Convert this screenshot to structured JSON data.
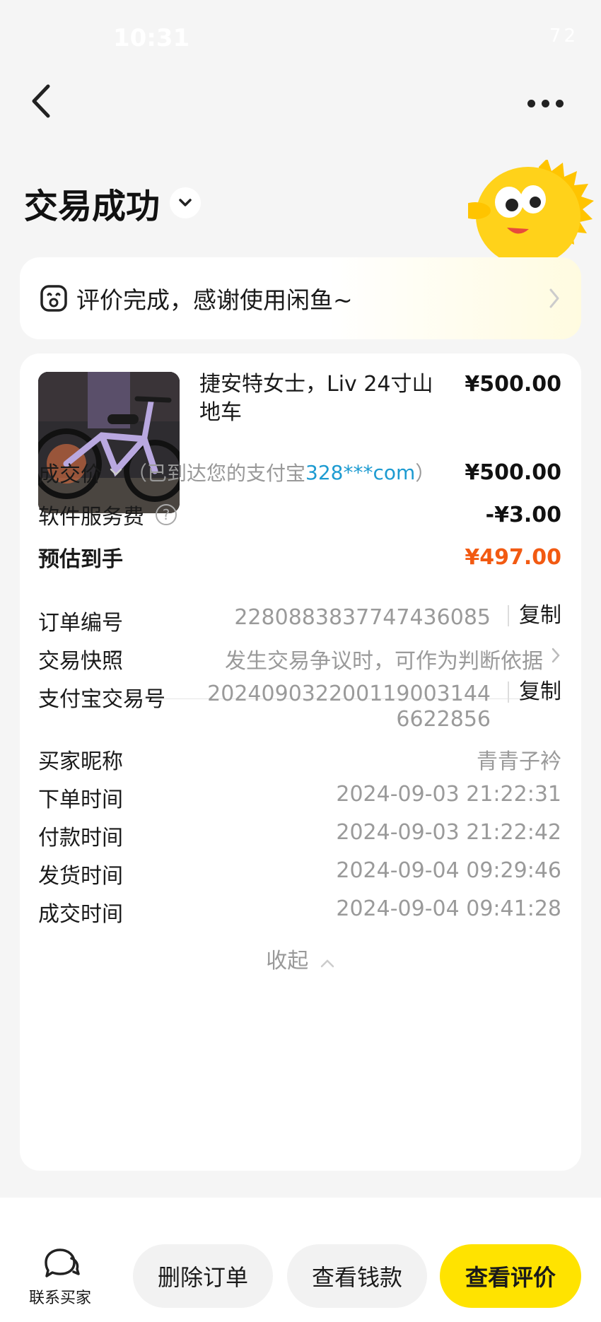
{
  "status": {
    "time": "10:31",
    "battery": "72"
  },
  "header": {
    "title": "交易成功"
  },
  "review_banner": {
    "text": "评价完成，感谢使用闲鱼~"
  },
  "product": {
    "title": "捷安特女士，Liv 24寸山地车",
    "price": "¥500.00"
  },
  "summary": {
    "deal_price_label": "成交价",
    "deal_price_note_prefix": "（已到达您的支付宝",
    "deal_price_note_account": "328***com",
    "deal_price_note_suffix": "）",
    "deal_price_value": "¥500.00",
    "service_fee_label": "软件服务费",
    "service_fee_value": "-¥3.00",
    "estimated_label": "预估到手",
    "estimated_value": "¥497.00"
  },
  "order_info": {
    "order_no_label": "订单编号",
    "order_no_value": "2280883837747436085",
    "copy_label": "复制",
    "snapshot_label": "交易快照",
    "snapshot_value": "发生交易争议时，可作为判断依据",
    "alipay_no_label": "支付宝交易号",
    "alipay_no_line1": "202409032200119003144",
    "alipay_no_line2": "6622856",
    "buyer_label": "买家昵称",
    "buyer_value": "青青子衿",
    "order_time_label": "下单时间",
    "order_time_value": "2024-09-03 21:22:31",
    "pay_time_label": "付款时间",
    "pay_time_value": "2024-09-03 21:22:42",
    "ship_time_label": "发货时间",
    "ship_time_value": "2024-09-04 09:29:46",
    "deal_time_label": "成交时间",
    "deal_time_value": "2024-09-04 09:41:28",
    "collapse_label": "收起"
  },
  "bottom": {
    "contact_label": "联系买家",
    "delete_label": "删除订单",
    "view_money_label": "查看钱款",
    "view_review_label": "查看评价"
  },
  "colors": {
    "accent_yellow": "#ffe300",
    "price_orange": "#f25a12",
    "link_blue": "#1d9bd1"
  }
}
